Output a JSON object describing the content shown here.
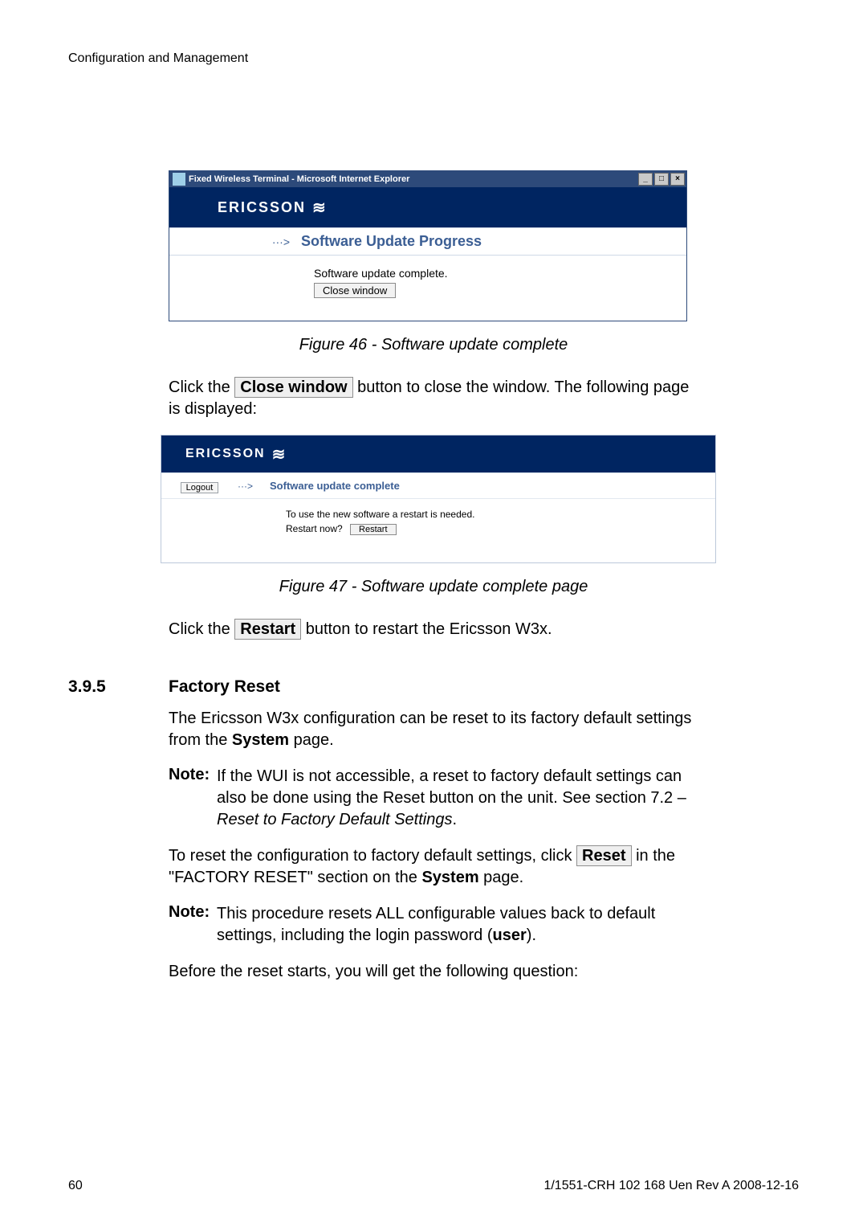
{
  "header": {
    "running": "Configuration and Management"
  },
  "fig46": {
    "window_title": "Fixed Wireless Terminal - Microsoft Internet Explorer",
    "brand": "ERICSSON",
    "heading": "Software Update Progress",
    "status": "Software update complete.",
    "button": "Close window",
    "caption": "Figure 46 - Software update complete"
  },
  "para46a_pre": "Click the ",
  "para46a_btn": "Close window",
  "para46a_post": " button to close the window. The following page is displayed:",
  "fig47": {
    "brand": "ERICSSON",
    "logout": "Logout",
    "heading": "Software update complete",
    "line1": "To use the new software a restart is needed.",
    "line2_label": "Restart now?",
    "line2_btn": "Restart",
    "caption": "Figure 47 - Software update complete page"
  },
  "para47a_pre": "Click the ",
  "para47a_btn": "Restart",
  "para47a_post": " button to restart the Ericsson W3x.",
  "section": {
    "num": "3.9.5",
    "title": "Factory Reset"
  },
  "fr_para1_a": "The Ericsson W3x configuration can be reset to its factory default settings from the ",
  "fr_para1_b": "System",
  "fr_para1_c": " page.",
  "fr_note1_label": "Note:",
  "fr_note1_text_a": "If the WUI is not accessible, a reset to factory default settings can also be done using the Reset button on the unit. See section 7.2 – ",
  "fr_note1_text_b": "Reset to Factory Default Settings",
  "fr_note1_text_c": ".",
  "fr_para2_a": "To reset the configuration to factory default settings, click ",
  "fr_para2_btn": "Reset",
  "fr_para2_b": " in the \"FACTORY RESET\" section on the ",
  "fr_para2_c": "System",
  "fr_para2_d": " page.",
  "fr_note2_label": "Note:",
  "fr_note2_text_a": "This procedure resets ALL configurable values back to default settings, including the login password (",
  "fr_note2_text_b": "user",
  "fr_note2_text_c": ").",
  "fr_para3": "Before the reset starts, you will get the following question:",
  "footer": {
    "page": "60",
    "docid": "1/1551-CRH 102 168 Uen Rev A  2008-12-16"
  }
}
